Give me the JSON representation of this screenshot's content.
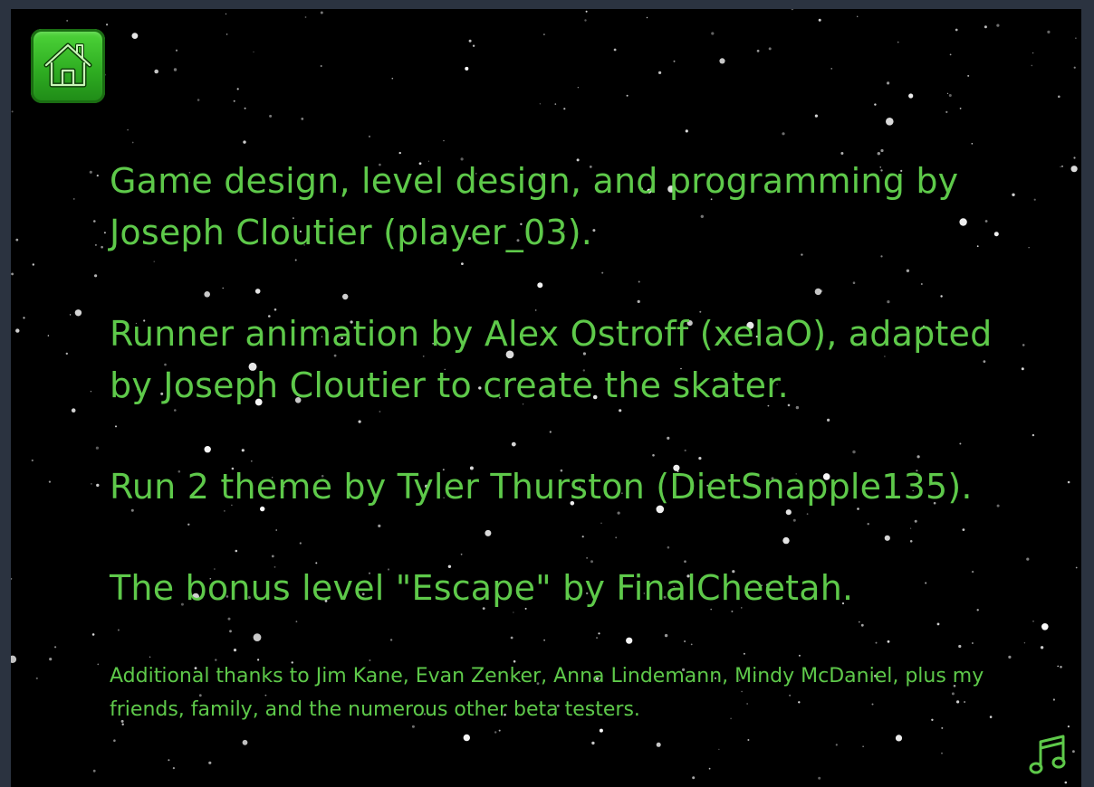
{
  "credits": {
    "lines": [
      "Game design, level design, and programming by Joseph Cloutier (player_03).",
      "Runner animation by Alex Ostroff (xelaO), adapted by Joseph Cloutier to create the skater.",
      "Run 2 theme by Tyler Thurston (DietSnapple135).",
      "The bonus level \"Escape\" by FinalCheetah."
    ],
    "thanks": "Additional thanks to Jim Kane,  Evan Zenker,  Anna Lindemann, Mindy McDaniel, plus my friends, family, and the numerous other beta testers."
  },
  "icons": {
    "home": "home-icon",
    "music": "music-note-icon"
  },
  "colors": {
    "text": "#5ec94a",
    "background": "#000000",
    "button": "#2fae22"
  }
}
